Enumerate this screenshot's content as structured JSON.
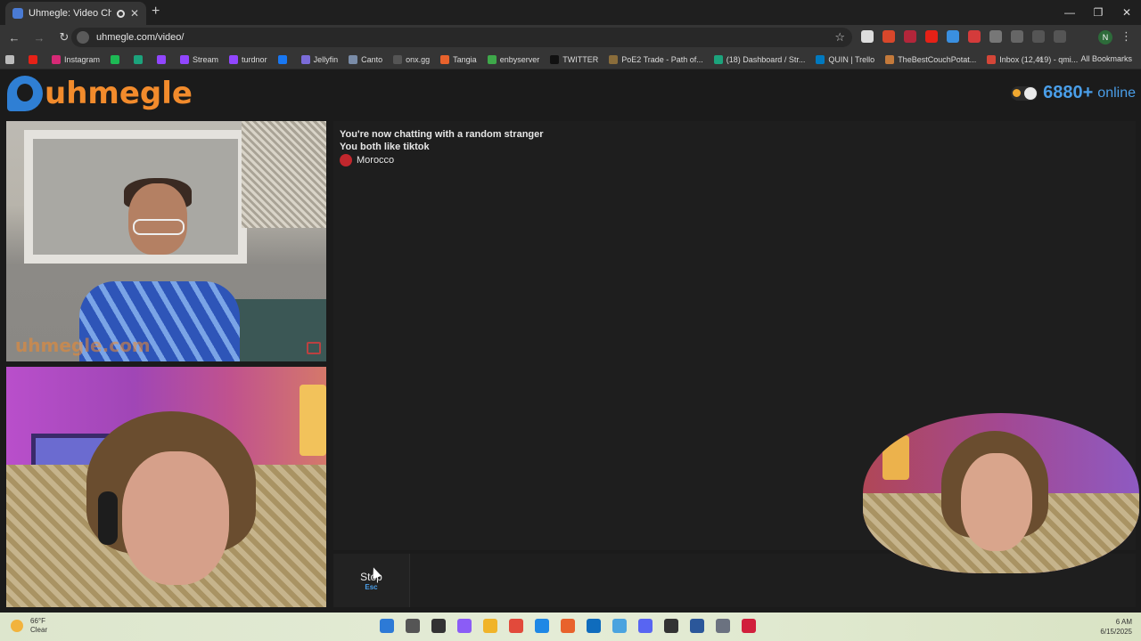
{
  "browser": {
    "tab_title": "Uhmegle: Video Chat | Om",
    "new_tab": "+",
    "close_tab": "✕",
    "url": "uhmegle.com/video/",
    "window_controls": {
      "minimize": "—",
      "restore": "❐",
      "close": "✕"
    },
    "nav": {
      "back": "←",
      "forward": "→",
      "reload": "↻"
    },
    "profile_initial": "N",
    "menu": "⋮",
    "star": "☆"
  },
  "bookmarks": {
    "items": [
      {
        "label": "",
        "color": "#e62117"
      },
      {
        "label": "Instagram",
        "color": "#d62976"
      },
      {
        "label": "",
        "color": "#1db954"
      },
      {
        "label": "",
        "color": "#1ca37c"
      },
      {
        "label": "",
        "color": "#9146ff"
      },
      {
        "label": "Stream",
        "color": "#9146ff"
      },
      {
        "label": "turdnor",
        "color": "#9146ff"
      },
      {
        "label": "",
        "color": "#1877f2"
      },
      {
        "label": "Jellyfin",
        "color": "#7b6cd9"
      },
      {
        "label": "Canto",
        "color": "#7a8ca8"
      },
      {
        "label": "onx.gg",
        "color": "#555555"
      },
      {
        "label": "Tangia",
        "color": "#e8622c"
      },
      {
        "label": "enbyserver",
        "color": "#3ea84a"
      },
      {
        "label": "TWITTER",
        "color": "#111111"
      },
      {
        "label": "PoE2 Trade - Path of...",
        "color": "#8a6d3b"
      },
      {
        "label": "(18) Dashboard / Str...",
        "color": "#1ca37c"
      },
      {
        "label": "QUIN | Trello",
        "color": "#0079bf"
      },
      {
        "label": "TheBestCouchPotat...",
        "color": "#c47a3b"
      },
      {
        "label": "Inbox (12,419) - qmi...",
        "color": "#d44638"
      }
    ],
    "overflow": "»",
    "all_bookmarks": "All Bookmarks"
  },
  "site": {
    "logo_text": "uhmegle",
    "online_count": "6880+",
    "online_label": "online",
    "watermark": "uhmegle.com"
  },
  "chat": {
    "messages": [
      "You're now chatting with a random stranger",
      "You both like tiktok"
    ],
    "country": "Morocco",
    "stop_label": "Stop",
    "stop_key": "Esc"
  },
  "taskbar": {
    "temp": "66°F",
    "condition": "Clear",
    "time": "6 AM",
    "date": "6/15/2025"
  },
  "colors": {
    "accent_orange": "#f28b2c",
    "accent_blue": "#4a9ee8"
  }
}
